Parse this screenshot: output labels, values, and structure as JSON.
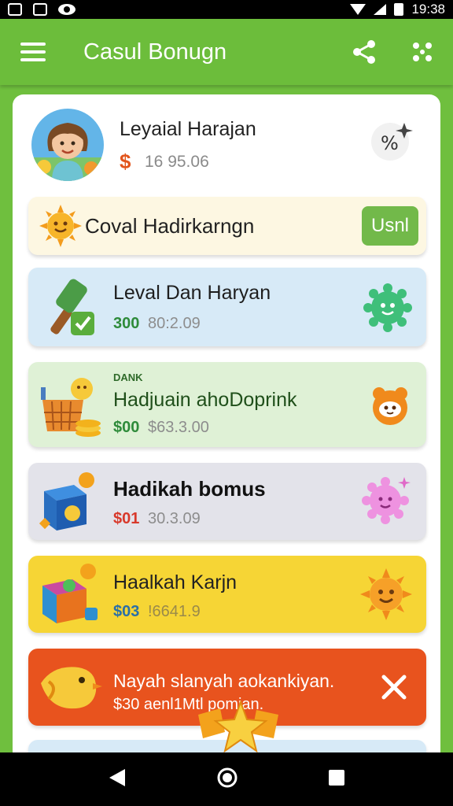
{
  "status_bar": {
    "time": "19:38"
  },
  "app_bar": {
    "title": "Casul Bonugn"
  },
  "profile": {
    "name": "Leyaial Harajan",
    "currency": "$",
    "balance": "16 95.06"
  },
  "promo": {
    "title": "Coval Hadirkarngn",
    "button_label": "Usnl"
  },
  "rows": [
    {
      "title": "Leval Dan Haryan",
      "amount": "300",
      "time": "80:2.09"
    },
    {
      "label": "DANK",
      "title": "Hadjuain  ahoDoprink",
      "amount": "$00",
      "time": "$63.3.00"
    },
    {
      "title": "Hadikah bomus",
      "amount": "$01",
      "time": "30.3.09"
    },
    {
      "title": "Haalkah Karjn",
      "amount": "$03",
      "time": "!6641.9"
    }
  ],
  "notification": {
    "title": "Nayah slanyah aokankiyan.",
    "subtitle": "$30 aenl1Mtl pomian."
  },
  "colors": {
    "app_bar": "#6cbd3b",
    "promo_button": "#72b94a",
    "row_blue": "#d7eaf7",
    "row_green": "#dff1d6",
    "row_gray": "#e3e3ea",
    "row_yellow": "#f6d535",
    "notification": "#e8531e"
  }
}
